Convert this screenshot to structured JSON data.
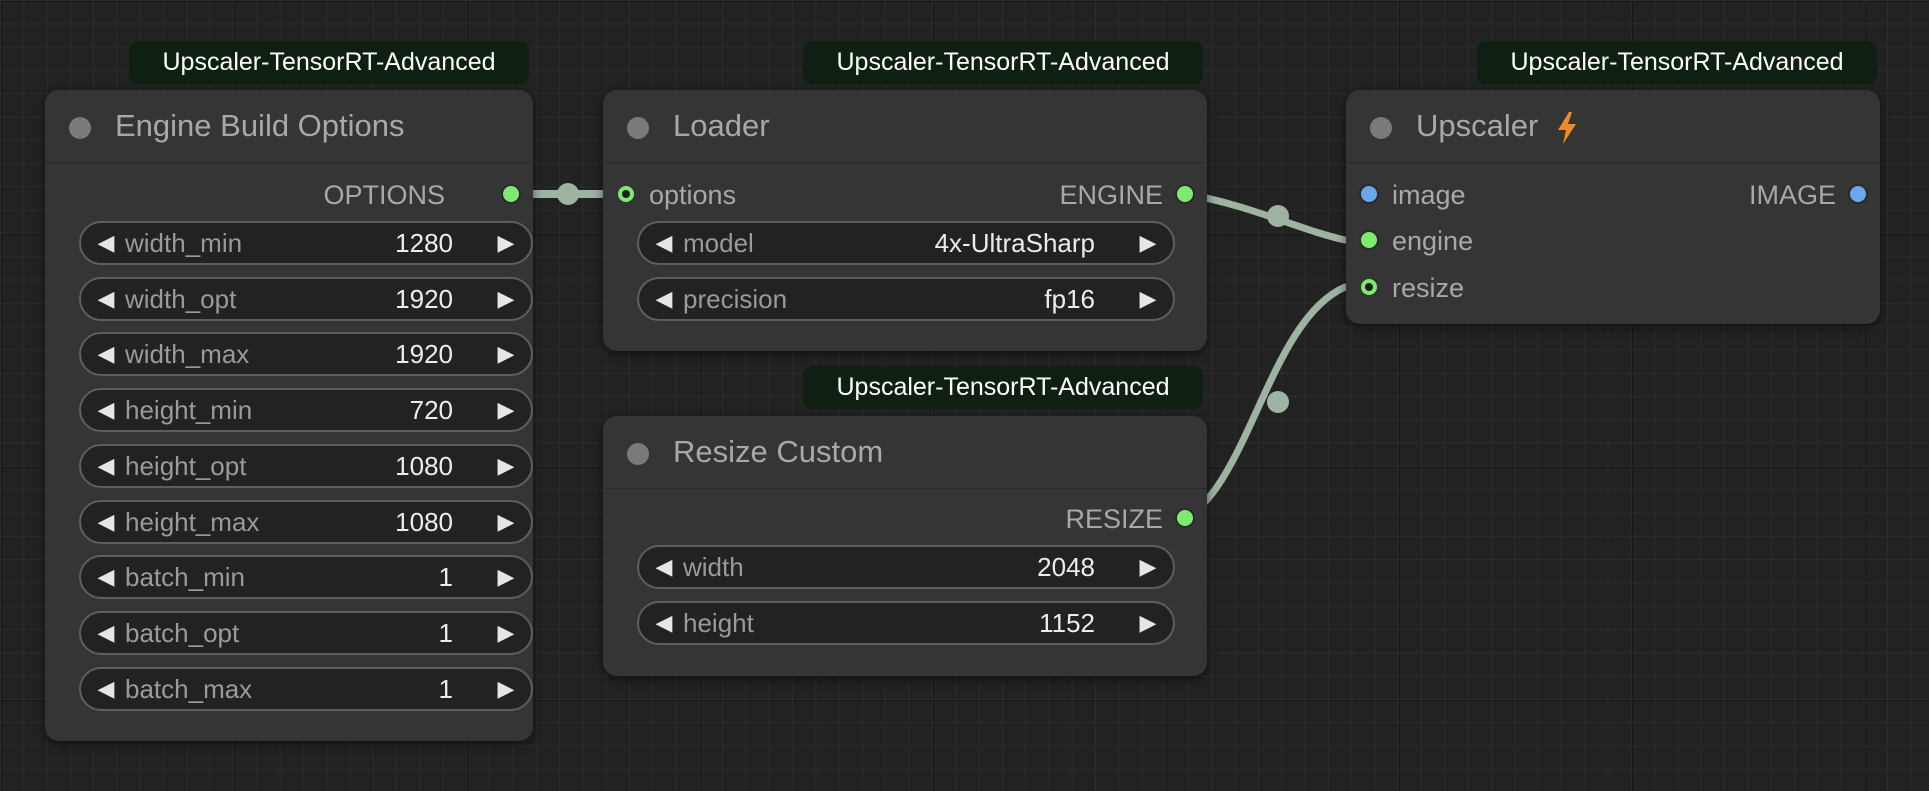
{
  "badge_label": "Upscaler-TensorRT-Advanced",
  "colors": {
    "canvas": "#222222",
    "node_body": "#353535",
    "link": "#9fb3a2",
    "slot_green": "#7dea6f",
    "slot_blue": "#6aa8ee",
    "bolt": "#f08a2a"
  },
  "nodes": {
    "engine_build_options": {
      "title": "Engine Build Options",
      "output": "OPTIONS",
      "widgets": [
        {
          "name": "width_min",
          "value": "1280"
        },
        {
          "name": "width_opt",
          "value": "1920"
        },
        {
          "name": "width_max",
          "value": "1920"
        },
        {
          "name": "height_min",
          "value": "720"
        },
        {
          "name": "height_opt",
          "value": "1080"
        },
        {
          "name": "height_max",
          "value": "1080"
        },
        {
          "name": "batch_min",
          "value": "1"
        },
        {
          "name": "batch_opt",
          "value": "1"
        },
        {
          "name": "batch_max",
          "value": "1"
        }
      ]
    },
    "loader": {
      "title": "Loader",
      "input": "options",
      "output": "ENGINE",
      "widgets": [
        {
          "name": "model",
          "value": "4x-UltraSharp"
        },
        {
          "name": "precision",
          "value": "fp16"
        }
      ]
    },
    "resize_custom": {
      "title": "Resize Custom",
      "output": "RESIZE",
      "widgets": [
        {
          "name": "width",
          "value": "2048"
        },
        {
          "name": "height",
          "value": "1152"
        }
      ]
    },
    "upscaler": {
      "title": "Upscaler",
      "inputs": [
        "image",
        "engine",
        "resize"
      ],
      "output": "IMAGE",
      "icon": "lightning-bolt-icon"
    }
  },
  "widget_arrows": {
    "left": "◀",
    "right": "▶"
  }
}
